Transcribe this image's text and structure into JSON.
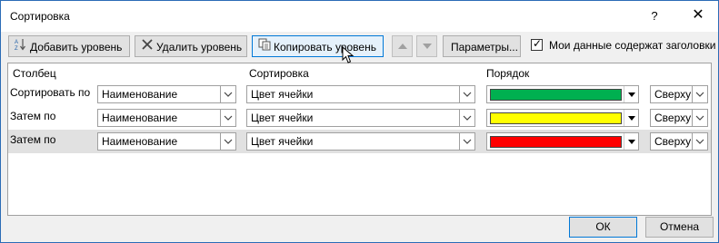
{
  "window": {
    "title": "Сортировка",
    "help_glyph": "?",
    "close_glyph": "✕"
  },
  "toolbar": {
    "add_level": "Добавить уровень",
    "delete_level": "Удалить уровень",
    "copy_level": "Копировать уровень",
    "options": "Параметры...",
    "headers_checkbox_label": "Мои данные содержат заголовки",
    "headers_checked": true
  },
  "grid": {
    "headers": {
      "column": "Столбец",
      "sort_on": "Сортировка",
      "order": "Порядок"
    },
    "rows": [
      {
        "label": "Сортировать по",
        "column": "Наименование",
        "sort_on": "Цвет ячейки",
        "color": "#00b050",
        "order": "Сверху"
      },
      {
        "label": "Затем по",
        "column": "Наименование",
        "sort_on": "Цвет ячейки",
        "color": "#ffff00",
        "order": "Сверху"
      },
      {
        "label": "Затем по",
        "column": "Наименование",
        "sort_on": "Цвет ячейки",
        "color": "#ff0000",
        "order": "Сверху"
      }
    ]
  },
  "footer": {
    "ok": "ОК",
    "cancel": "Отмена"
  },
  "icons": {
    "add": "az-sort-icon",
    "delete": "x-delete-icon",
    "copy": "copy-icon",
    "up": "move-up-icon",
    "down": "move-down-icon",
    "cursor": "mouse-pointer-icon"
  }
}
